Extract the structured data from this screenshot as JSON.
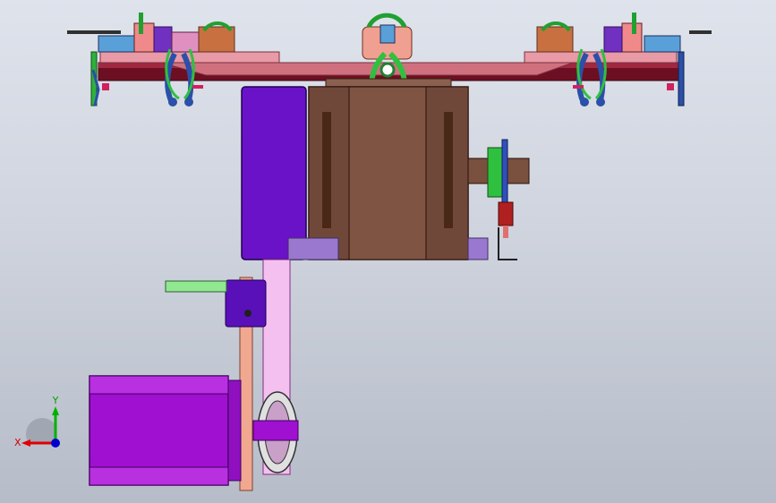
{
  "triad": {
    "x_label": "X",
    "y_label": "Y",
    "x_color": "#e00000",
    "y_color": "#00b000",
    "z_color": "#0000cc"
  },
  "colors": {
    "background_top": "#dfe3ec",
    "background_bottom": "#b6bcc8",
    "turntable_plate": "#c87882",
    "turntable_dark": "#7a1426",
    "gearbox_brown": "#7a503e",
    "motor_purple": "#a010d0",
    "cover_purple": "#6a12c8",
    "belt_pink": "#f4c0f0",
    "arm_green": "#90e890",
    "clamp_blue": "#2a50a8",
    "clamp_green": "#30c040",
    "bracket_salmon": "#f0a890"
  },
  "icons": [
    "triad-axis-icon"
  ]
}
